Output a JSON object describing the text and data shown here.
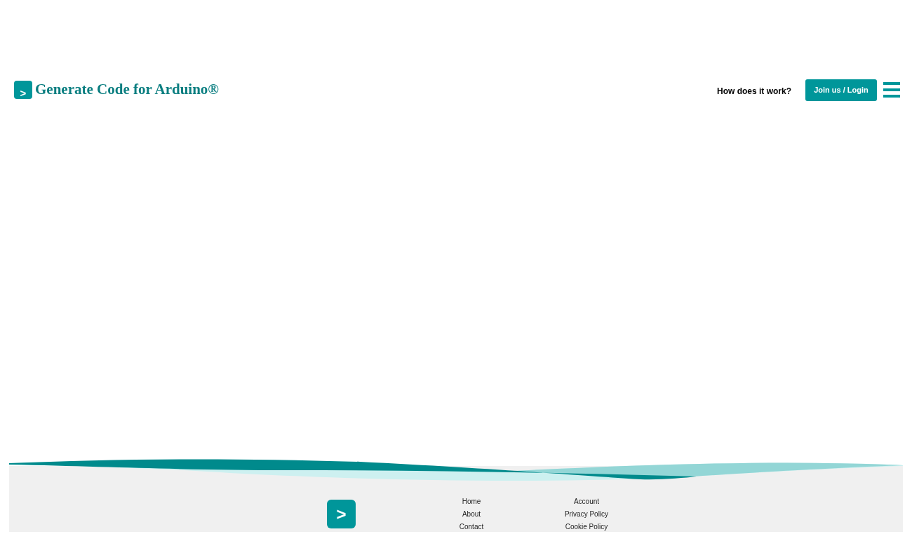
{
  "header": {
    "logo_mark": ">",
    "title": "Generate Code for Arduino®",
    "nav_link": "How does it work?",
    "login_button": "Join us / Login"
  },
  "footer": {
    "logo_mark": ">",
    "columns": [
      [
        "Home",
        "About",
        "Contact"
      ],
      [
        "Account",
        "Privacy Policy",
        "Cookie Policy"
      ]
    ]
  }
}
